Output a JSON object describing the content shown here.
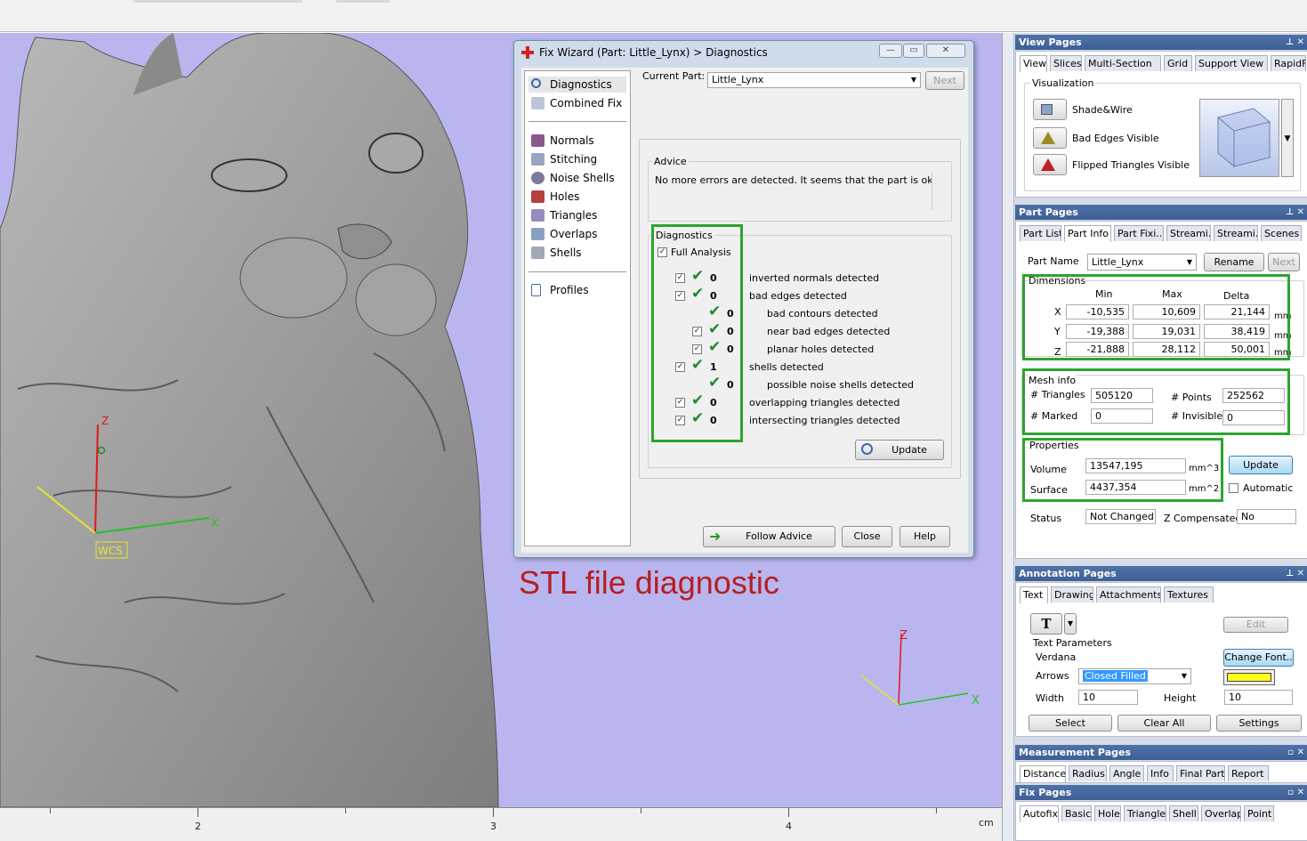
{
  "dialog": {
    "title": "Fix Wizard (Part: Little_Lynx) > Diagnostics",
    "nav": {
      "top": [
        "Diagnostics",
        "Combined Fix"
      ],
      "mid": [
        "Normals",
        "Stitching",
        "Noise Shells",
        "Holes",
        "Triangles",
        "Overlaps",
        "Shells"
      ],
      "bottom": [
        "Profiles"
      ]
    },
    "current_part_label": "Current Part:",
    "current_part_value": "Little_Lynx",
    "next_label": "Next",
    "advice_label": "Advice",
    "advice_text": "No more errors are detected. It seems that the part is ok.",
    "diagnostics_label": "Diagnostics",
    "full_analysis_label": "Full Analysis",
    "rows": [
      {
        "count": "0",
        "text": "inverted normals detected"
      },
      {
        "count": "0",
        "text": "bad edges detected"
      },
      {
        "count": "0",
        "text": "bad contours detected"
      },
      {
        "count": "0",
        "text": "near bad edges detected"
      },
      {
        "count": "0",
        "text": "planar holes detected"
      },
      {
        "count": "1",
        "text": "shells detected"
      },
      {
        "count": "0",
        "text": "possible noise shells detected"
      },
      {
        "count": "0",
        "text": "overlapping triangles detected"
      },
      {
        "count": "0",
        "text": "intersecting triangles detected"
      }
    ],
    "update_label": "Update",
    "follow_advice_label": "Follow Advice",
    "close_label": "Close",
    "help_label": "Help"
  },
  "viewport": {
    "annotation": "STL file diagnostic",
    "annotation_color": "#b51f1f",
    "wcs_label": "WCS",
    "axis_z": "Z",
    "axis_x": "X",
    "ruler_labels": [
      "2",
      "3",
      "4"
    ],
    "ruler_unit": "cm",
    "background": "#b9b6ef"
  },
  "view_pages": {
    "title": "View Pages",
    "tabs": [
      "View",
      "Slices",
      "Multi-Section",
      "Grid",
      "Support View",
      "RapidFit View"
    ],
    "visualization_label": "Visualization",
    "options": [
      "Shade&Wire",
      "Bad Edges Visible",
      "Flipped Triangles Visible"
    ]
  },
  "part_pages": {
    "title": "Part Pages",
    "tabs": [
      "Part List",
      "Part Info",
      "Part Fixi...",
      "Streami...",
      "Streami...",
      "Scenes"
    ],
    "part_name_label": "Part Name",
    "part_name_value": "Little_Lynx",
    "rename_label": "Rename",
    "next_label": "Next",
    "dimensions_label": "Dimensions",
    "dim_headers": [
      "Min",
      "Max",
      "Delta"
    ],
    "dims": [
      {
        "axis": "X",
        "min": "-10,535",
        "max": "10,609",
        "delta": "21,144",
        "unit": "mm"
      },
      {
        "axis": "Y",
        "min": "-19,388",
        "max": "19,031",
        "delta": "38,419",
        "unit": "mm"
      },
      {
        "axis": "Z",
        "min": "-21,888",
        "max": "28,112",
        "delta": "50,001",
        "unit": "mm"
      }
    ],
    "mesh_info_label": "Mesh info",
    "triangles_label": "# Triangles",
    "triangles_value": "505120",
    "points_label": "# Points",
    "points_value": "252562",
    "marked_label": "# Marked",
    "marked_value": "0",
    "invisible_label": "# Invisible",
    "invisible_value": "0",
    "properties_label": "Properties",
    "volume_label": "Volume",
    "volume_value": "13547,195",
    "volume_unit": "mm^3",
    "surface_label": "Surface",
    "surface_value": "4437,354",
    "surface_unit": "mm^2",
    "update_label": "Update",
    "automatic_label": "Automatic",
    "status_label": "Status",
    "status_value": "Not Changed",
    "zcomp_label": "Z Compensated",
    "zcomp_value": "No"
  },
  "annotation_pages": {
    "title": "Annotation Pages",
    "tabs": [
      "Text",
      "Drawing",
      "Attachments",
      "Textures"
    ],
    "edit_label": "Edit",
    "text_params_label": "Text Parameters",
    "font_value": "Verdana",
    "change_font_label": "Change Font..",
    "arrows_label": "Arrows",
    "arrows_value": "Closed Filled",
    "width_label": "Width",
    "width_value": "10",
    "height_label": "Height",
    "height_value": "10",
    "select_label": "Select",
    "clear_all_label": "Clear All",
    "settings_label": "Settings",
    "swatch_color": "#ffff1a"
  },
  "measurement_pages": {
    "title": "Measurement Pages",
    "tabs": [
      "Distance",
      "Radius",
      "Angle",
      "Info",
      "Final Part",
      "Report"
    ]
  },
  "fix_pages": {
    "title": "Fix Pages",
    "tabs": [
      "Autofix",
      "Basic",
      "Hole",
      "Triangle",
      "Shell",
      "Overlap",
      "Point"
    ]
  },
  "colors": {
    "highlight_green": "#2ea32e",
    "panel_header": "#4f72a8",
    "check_green": "#1e8a2e"
  }
}
